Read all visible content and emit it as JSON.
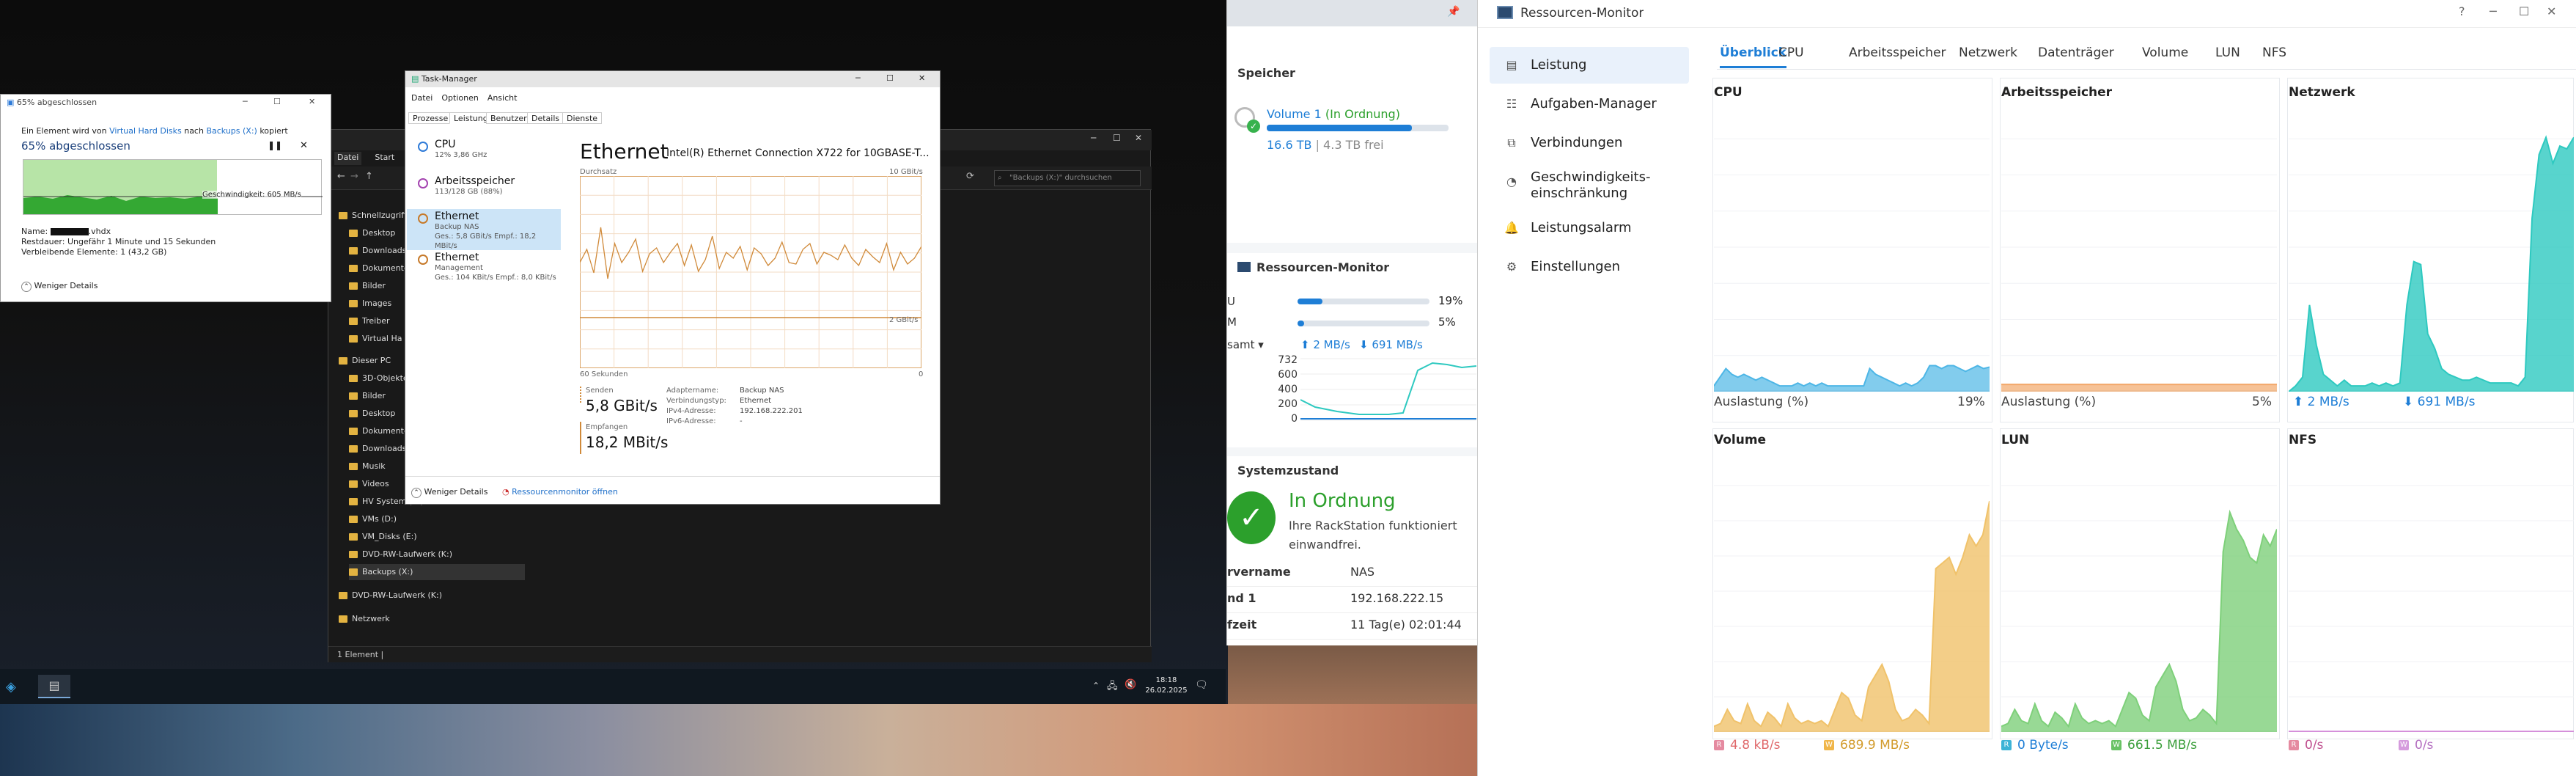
{
  "copy_dialog": {
    "title": "65% abgeschlossen",
    "line1_prefix": "Ein Element wird von",
    "source": "Virtual Hard Disks",
    "line1_mid": "nach",
    "dest": "Backups (X:)",
    "line1_suffix": "kopiert",
    "progress_label": "65% abgeschlossen",
    "progress_fraction": 0.65,
    "speed": "Geschwindigkeit: 605 MB/s",
    "name_label": "Name:",
    "name_value": ".vhdx",
    "remaining_time": "Restdauer: Ungefähr 1 Minute und 15 Sekunden",
    "remaining_items": "Verbleibende Elemente: 1 (43,2 GB)",
    "less_details": "Weniger Details"
  },
  "explorer": {
    "tabs": [
      "Datei",
      "Start"
    ],
    "search_placeholder": "\"Backups (X:)\" durchsuchen",
    "nav": [
      "Schnellzugriff",
      "Desktop",
      "Downloads",
      "Dokumente",
      "Bilder",
      "Images",
      "Treiber",
      "Virtual Ha",
      "Dieser PC",
      "3D-Objekte",
      "Bilder",
      "Desktop",
      "Dokumente",
      "Downloads",
      "Musik",
      "Videos",
      "HV System (C:)",
      "VMs (D:)",
      "VM_Disks (E:)",
      "DVD-RW-Laufwerk (K:)",
      "Backups (X:)",
      "DVD-RW-Laufwerk (K:)",
      "Netzwerk"
    ],
    "status": "1 Element"
  },
  "taskmanager": {
    "title": "Task-Manager",
    "menu": [
      "Datei",
      "Optionen",
      "Ansicht"
    ],
    "tabs": [
      "Prozesse",
      "Leistung",
      "Benutzer",
      "Details",
      "Dienste"
    ],
    "resources": [
      {
        "name": "CPU",
        "detail": "12% 3,86 GHz",
        "detail2": ""
      },
      {
        "name": "Arbeitsspeicher",
        "detail": "113/128 GB (88%)",
        "detail2": ""
      },
      {
        "name": "Ethernet",
        "detail": "Backup NAS",
        "detail2": "Ges.: 5,8 GBit/s Empf.: 18,2 MBit/s"
      },
      {
        "name": "Ethernet",
        "detail": "Management",
        "detail2": "Ges.: 104 KBit/s Empf.: 8,0 KBit/s"
      }
    ],
    "heading": "Ethernet",
    "adapter": "Intel(R) Ethernet Connection X722 for 10GBASE-T...",
    "throughput_label": "Durchsatz",
    "max_label": "10 GBit/s",
    "mid_label": "2 GBit/s",
    "time_label": "60 Sekunden",
    "zero_label": "0",
    "send_label": "Senden",
    "send_value": "5,8 GBit/s",
    "recv_label": "Empfangen",
    "recv_value": "18,2 MBit/s",
    "props": [
      {
        "k": "Adaptername:",
        "v": "Backup NAS"
      },
      {
        "k": "Verbindungstyp:",
        "v": "Ethernet"
      },
      {
        "k": "IPv4-Adresse:",
        "v": "192.168.222.201"
      },
      {
        "k": "IPv6-Adresse:",
        "v": "-"
      }
    ],
    "less_details": "Weniger Details",
    "open_rm": "Ressourcenmonitor öffnen"
  },
  "taskbar": {
    "time": "18:18",
    "date": "26.02.2025"
  },
  "nas": {
    "storage_title": "Speicher",
    "volume_name": "Volume 1",
    "volume_status": "(In Ordnung)",
    "volume_used_fraction": 0.8,
    "volume_size": "16.6 TB",
    "volume_free": "4.3 TB frei",
    "rm_title": "Ressourcen-Monitor",
    "cpu_short": "U",
    "cpu_value": "19%",
    "cpu_fraction": 0.19,
    "ram_short": "M",
    "ram_value": "5%",
    "ram_fraction": 0.05,
    "net_label": "samt",
    "net_up": "2 MB/s",
    "net_down": "691 MB/s",
    "y_ticks": [
      "732",
      "600",
      "400",
      "200",
      "0"
    ],
    "sys_title": "Systemzustand",
    "sys_status": "In Ordnung",
    "sys_desc": "Ihre RackStation funktioniert einwandfrei.",
    "rows": [
      {
        "k": "rvername",
        "v": "NAS"
      },
      {
        "k": "nd 1",
        "v": "192.168.222.15"
      },
      {
        "k": "fzeit",
        "v": "11 Tag(e) 02:01:44"
      }
    ]
  },
  "resource_monitor": {
    "title": "Ressourcen-Monitor",
    "sidebar": [
      "Leistung",
      "Aufgaben-Manager",
      "Verbindungen",
      "Geschwindigkeits-\neinschränkung",
      "Leistungsalarm",
      "Einstellungen"
    ],
    "tabs": [
      "Überblick",
      "CPU",
      "Arbeitsspeicher",
      "Netzwerk",
      "Datenträger",
      "Volume",
      "LUN",
      "NFS"
    ],
    "panels": {
      "cpu": {
        "title": "CPU",
        "label": "Auslastung  (%)",
        "value": "19%"
      },
      "mem": {
        "title": "Arbeitsspeicher",
        "label": "Auslastung  (%)",
        "value": "5%"
      },
      "net": {
        "title": "Netzwerk",
        "up": "2 MB/s",
        "down": "691 MB/s"
      },
      "vol": {
        "title": "Volume",
        "r": "4.8 kB/s",
        "w": "689.9 MB/s"
      },
      "lun": {
        "title": "LUN",
        "r": "0 Byte/s",
        "w": "661.5 MB/s"
      },
      "nfs": {
        "title": "NFS",
        "r": "0/s",
        "w": "0/s"
      }
    },
    "letters": {
      "r": "R",
      "w": "W"
    },
    "colors": {
      "accent": "#1e7ed6",
      "cpu": "#4db6e6",
      "mem": "#f2a86a",
      "net": "#2ec9c0",
      "vol": "#f0c26a",
      "lun": "#7ed07a",
      "nfs": "#d38bd8"
    }
  }
}
